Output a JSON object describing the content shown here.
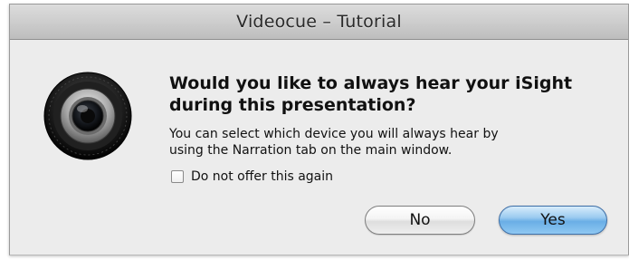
{
  "window": {
    "title": "Videocue – Tutorial"
  },
  "dialog": {
    "icon": "isight-camera-icon",
    "heading_line1": "Would you like to always hear your iSight",
    "heading_line2": "during this presentation?",
    "message_line1": "You can select which device you will always hear by",
    "message_line2": "using the Narration tab on the main window.",
    "checkbox": {
      "label": "Do not offer this again",
      "checked": false
    },
    "buttons": {
      "no_label": "No",
      "yes_label": "Yes"
    }
  },
  "colors": {
    "default_button": "#6aaee6",
    "window_background": "#ececec"
  }
}
